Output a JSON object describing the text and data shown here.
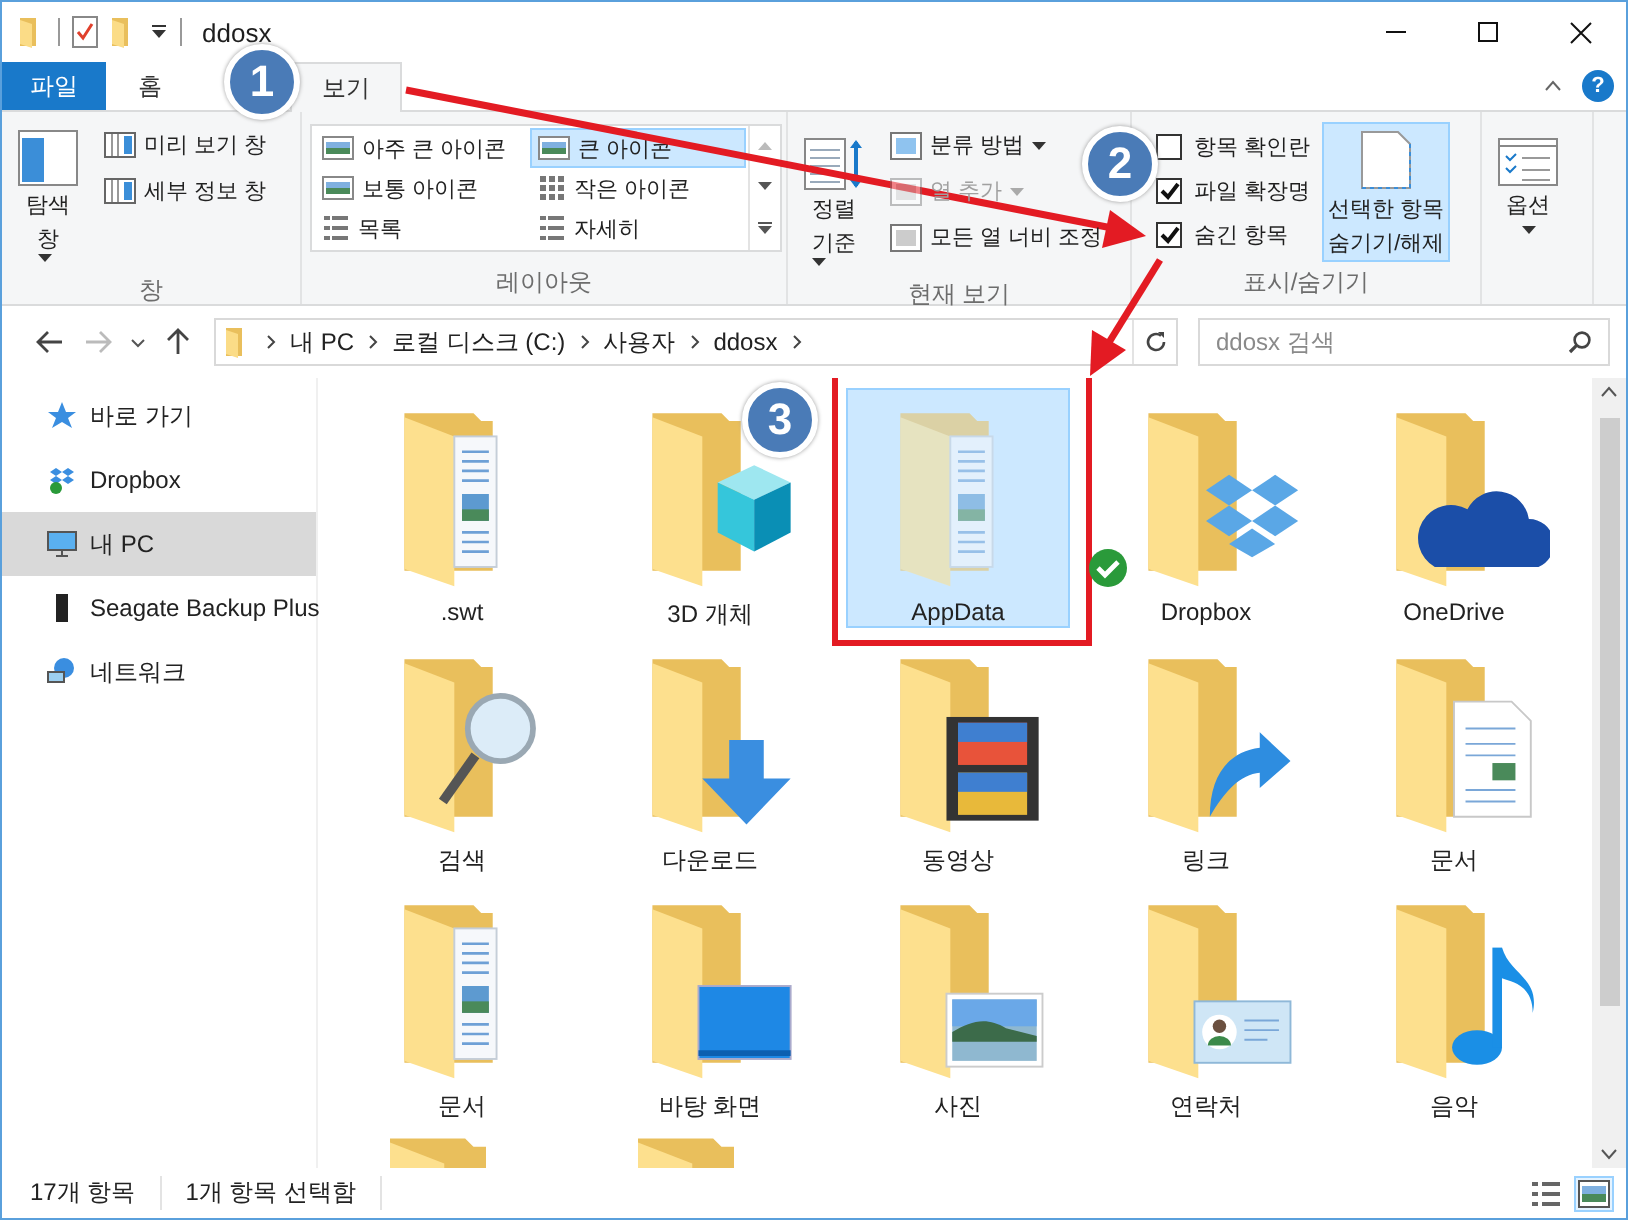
{
  "window": {
    "title": "ddosx"
  },
  "tabs": [
    {
      "label": "파일",
      "kind": "file",
      "selected": false
    },
    {
      "label": "홈",
      "kind": "tab",
      "selected": false
    },
    {
      "label": "보기",
      "kind": "tab",
      "selected": true
    }
  ],
  "help_button": {
    "label": "?"
  },
  "ribbon": {
    "pane_group": {
      "title": "창",
      "navigation_pane": {
        "lines": [
          "탐색",
          "창"
        ]
      },
      "items": [
        "미리 보기 창",
        "세부 정보 창"
      ]
    },
    "layout_group": {
      "title": "레이아웃",
      "options": [
        {
          "label": "아주 큰 아이콘",
          "selected": false
        },
        {
          "label": "큰 아이콘",
          "selected": true
        },
        {
          "label": "보통 아이콘",
          "selected": false
        },
        {
          "label": "작은 아이콘",
          "selected": false
        },
        {
          "label": "목록",
          "selected": false
        },
        {
          "label": "자세히",
          "selected": false
        }
      ]
    },
    "current_view_group": {
      "title": "현재 보기",
      "sort": {
        "lines": [
          "정렬",
          "기준"
        ]
      },
      "items": [
        {
          "label": "분류 방법",
          "disabled": false,
          "dropdown": true
        },
        {
          "label": "열 추가",
          "disabled": true,
          "dropdown": true
        },
        {
          "label": "모든 열 너비 조정",
          "disabled": false,
          "dropdown": false
        }
      ]
    },
    "show_hide_group": {
      "title": "표시/숨기기",
      "checkboxes": [
        {
          "label": "항목 확인란",
          "checked": false
        },
        {
          "label": "파일 확장명",
          "checked": true
        },
        {
          "label": "숨긴 항목",
          "checked": true
        }
      ],
      "hide_selected": {
        "lines": [
          "선택한 항목",
          "숨기기/해제"
        ]
      }
    },
    "options": {
      "label": "옵션"
    }
  },
  "address_bar": {
    "crumbs": [
      "내 PC",
      "로컬 디스크 (C:)",
      "사용자",
      "ddosx"
    ]
  },
  "search": {
    "placeholder": "ddosx 검색"
  },
  "sidebar": {
    "items": [
      {
        "label": "바로 가기",
        "kind": "star",
        "selected": false
      },
      {
        "label": "Dropbox",
        "kind": "dropbox",
        "selected": false
      },
      {
        "label": "내 PC",
        "kind": "pc",
        "selected": true
      },
      {
        "label": "Seagate Backup Plus",
        "kind": "drive",
        "selected": false
      },
      {
        "label": "네트워크",
        "kind": "network",
        "selected": false
      }
    ]
  },
  "items": [
    {
      "label": ".swt",
      "kind": "docs",
      "selected": false,
      "hidden": false,
      "synced": false,
      "highlighted": false
    },
    {
      "label": "3D 개체",
      "kind": "cube",
      "selected": false,
      "hidden": false,
      "synced": false,
      "highlighted": false
    },
    {
      "label": "AppData",
      "kind": "docs",
      "selected": true,
      "hidden": true,
      "synced": false,
      "highlighted": true
    },
    {
      "label": "Dropbox",
      "kind": "dropbox",
      "selected": false,
      "hidden": false,
      "synced": true,
      "highlighted": false
    },
    {
      "label": "OneDrive",
      "kind": "cloud",
      "selected": false,
      "hidden": false,
      "synced": false,
      "highlighted": false
    },
    {
      "label": "검색",
      "kind": "search",
      "selected": false,
      "hidden": false,
      "synced": false,
      "highlighted": false
    },
    {
      "label": "다운로드",
      "kind": "download",
      "selected": false,
      "hidden": false,
      "synced": false,
      "highlighted": false
    },
    {
      "label": "동영상",
      "kind": "video",
      "selected": false,
      "hidden": false,
      "synced": false,
      "highlighted": false
    },
    {
      "label": "링크",
      "kind": "link",
      "selected": false,
      "hidden": false,
      "synced": false,
      "highlighted": false
    },
    {
      "label": "문서",
      "kind": "document",
      "selected": false,
      "hidden": false,
      "synced": false,
      "highlighted": false
    },
    {
      "label": "문서",
      "kind": "docs",
      "selected": false,
      "hidden": false,
      "synced": false,
      "highlighted": false
    },
    {
      "label": "바탕 화면",
      "kind": "desktop",
      "selected": false,
      "hidden": false,
      "synced": false,
      "highlighted": false
    },
    {
      "label": "사진",
      "kind": "picture",
      "selected": false,
      "hidden": false,
      "synced": false,
      "highlighted": false
    },
    {
      "label": "연락처",
      "kind": "contact",
      "selected": false,
      "hidden": false,
      "synced": false,
      "highlighted": false
    },
    {
      "label": "음악",
      "kind": "music",
      "selected": false,
      "hidden": false,
      "synced": false,
      "highlighted": false
    },
    {
      "kind": "plain",
      "selected": false,
      "hidden": false,
      "synced": false,
      "highlighted": false
    },
    {
      "kind": "plain",
      "selected": false,
      "hidden": false,
      "synced": false,
      "highlighted": false
    }
  ],
  "status_bar": {
    "count": "17개 항목",
    "selection": "1개 항목 선택함"
  },
  "annotations": {
    "markers": [
      {
        "label": "1"
      },
      {
        "label": "2"
      },
      {
        "label": "3"
      }
    ]
  }
}
